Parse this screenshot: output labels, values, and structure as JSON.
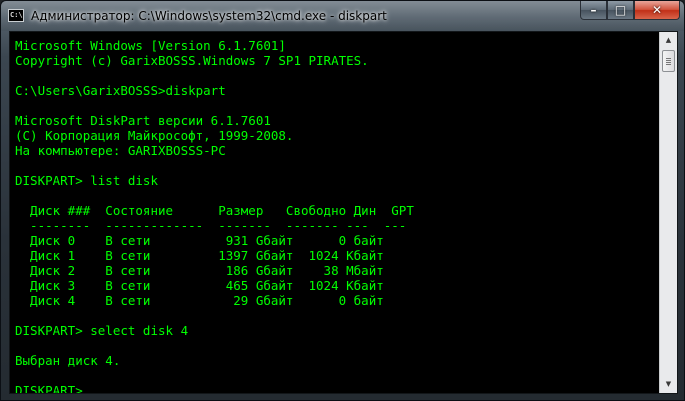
{
  "window": {
    "title": "Администратор: C:\\Windows\\system32\\cmd.exe - diskpart",
    "icon_label": "C:\\",
    "icon": "cmd-console-icon"
  },
  "caption_buttons": {
    "minimize": "–",
    "maximize": "□",
    "close": "✕"
  },
  "scrollbar": {
    "up_arrow": "▲",
    "down_arrow": "▼"
  },
  "colors": {
    "console_text": "#00ff00",
    "console_background": "#000000"
  },
  "console": {
    "lines": [
      "Microsoft Windows [Version 6.1.7601]",
      "Copyright (c) GarixBOSSS.Windows 7 SP1 PIRATES.",
      "",
      "C:\\Users\\GarixBOSSS>diskpart",
      "",
      "Microsoft DiskPart версии 6.1.7601",
      "(C) Корпорация Майкрософт, 1999-2008.",
      "На компьютере: GARIXBOSSS-PC",
      "",
      "DISKPART> list disk",
      "",
      "  Диск ###  Состояние      Размер   Свободно Дин  GPT",
      "  --------  -------------  -------  ------- ---  ---",
      "  Диск 0    В сети          931 Gбайт      0 байт",
      "  Диск 1    В сети         1397 Gбайт  1024 Kбайт",
      "  Диск 2    В сети          186 Gбайт    38 Mбайт",
      "  Диск 3    В сети          465 Gбайт  1024 Kбайт",
      "  Диск 4    В сети           29 Gбайт      0 байт",
      "",
      "DISKPART> select disk 4",
      "",
      "Выбран диск 4.",
      "",
      "DISKPART>"
    ]
  }
}
